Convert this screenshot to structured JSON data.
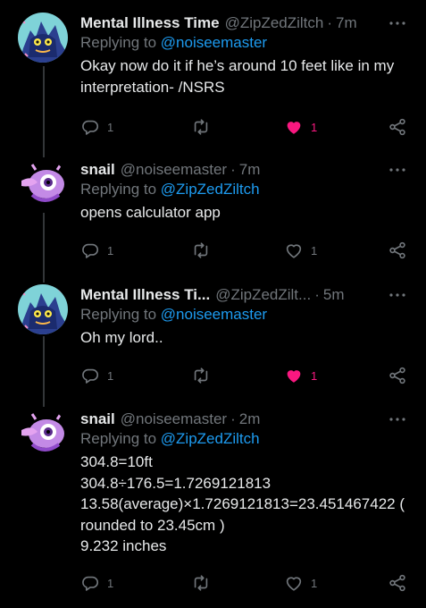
{
  "tweets": [
    {
      "display_name": "Mental Illness Time",
      "handle": "@ZipZedZiltch",
      "dot": "·",
      "time": "7m",
      "reply_prefix": "Replying to ",
      "reply_to": "@noiseemaster",
      "lines": [
        "Okay now do it if he’s around 10 feet like in my",
        "interpretation- /NSRS"
      ],
      "replies": "1",
      "retweets": "",
      "likes": "1",
      "liked": true,
      "avatar": "blue-creature"
    },
    {
      "display_name": "snail",
      "handle": "@noiseemaster",
      "dot": "·",
      "time": "7m",
      "reply_prefix": "Replying to ",
      "reply_to": "@ZipZedZiltch",
      "lines": [
        "opens calculator app"
      ],
      "replies": "1",
      "retweets": "",
      "likes": "1",
      "liked": false,
      "avatar": "purple-creature"
    },
    {
      "display_name": "Mental Illness Ti...",
      "handle": "@ZipZedZilt...",
      "dot": "·",
      "time": "5m",
      "reply_prefix": "Replying to ",
      "reply_to": "@noiseemaster",
      "lines": [
        "Oh my lord.."
      ],
      "replies": "1",
      "retweets": "",
      "likes": "1",
      "liked": true,
      "avatar": "blue-creature"
    },
    {
      "display_name": "snail",
      "handle": "@noiseemaster",
      "dot": "·",
      "time": "2m",
      "reply_prefix": "Replying to ",
      "reply_to": "@ZipZedZiltch",
      "lines": [
        "304.8=10ft",
        "304.8÷176.5=1.7269121813",
        "13.58(average)×1.7269121813=23.451467422 (",
        "rounded to 23.45cm )",
        "9.232 inches"
      ],
      "replies": "1",
      "retweets": "",
      "likes": "1",
      "liked": false,
      "avatar": "purple-creature"
    }
  ],
  "colors": {
    "background": "#000000",
    "text": "#e7e9ea",
    "muted": "#71767b",
    "link": "#1d9bf0",
    "like": "#f91880",
    "thread_line": "#333639"
  },
  "icons": [
    "more-icon",
    "reply-icon",
    "retweet-icon",
    "like-icon",
    "share-icon"
  ]
}
